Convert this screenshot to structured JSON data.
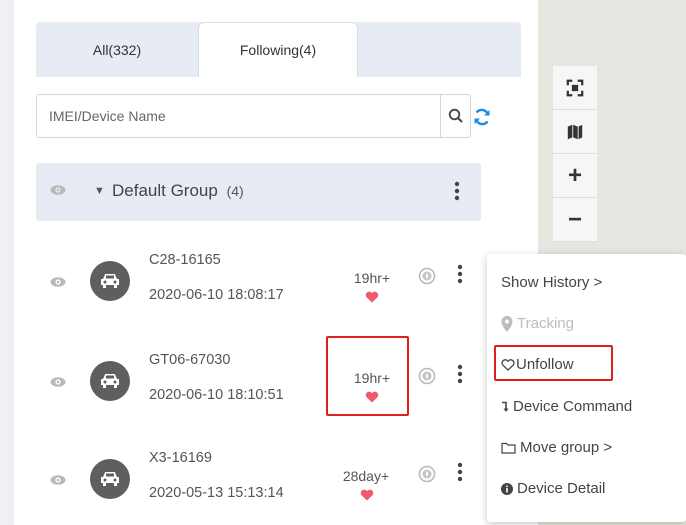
{
  "tabs": {
    "all": "All(332)",
    "following": "Following(4)"
  },
  "search": {
    "placeholder": "IMEI/Device Name"
  },
  "group": {
    "name": "Default Group",
    "count": "(4)"
  },
  "devices": [
    {
      "name": "C28-16165",
      "time": "2020-06-10 18:08:17",
      "duration": "19hr+"
    },
    {
      "name": "GT06-67030",
      "time": "2020-06-10 18:10:51",
      "duration": "19hr+"
    },
    {
      "name": "X3-16169",
      "time": "2020-05-13 15:13:14",
      "duration": "28day+"
    }
  ],
  "context_menu": {
    "show_history": "Show History >",
    "tracking": "Tracking",
    "unfollow": "Unfollow",
    "device_command": "Device Command",
    "move_group": "Move group >",
    "device_detail": "Device Detail"
  },
  "map_controls": {
    "zoom_in": "+",
    "zoom_out": "−"
  },
  "colors": {
    "heart": "#f05a6a",
    "highlight": "#e02020",
    "refresh": "#1e88e5",
    "tab_bg": "#e6ebf4"
  }
}
